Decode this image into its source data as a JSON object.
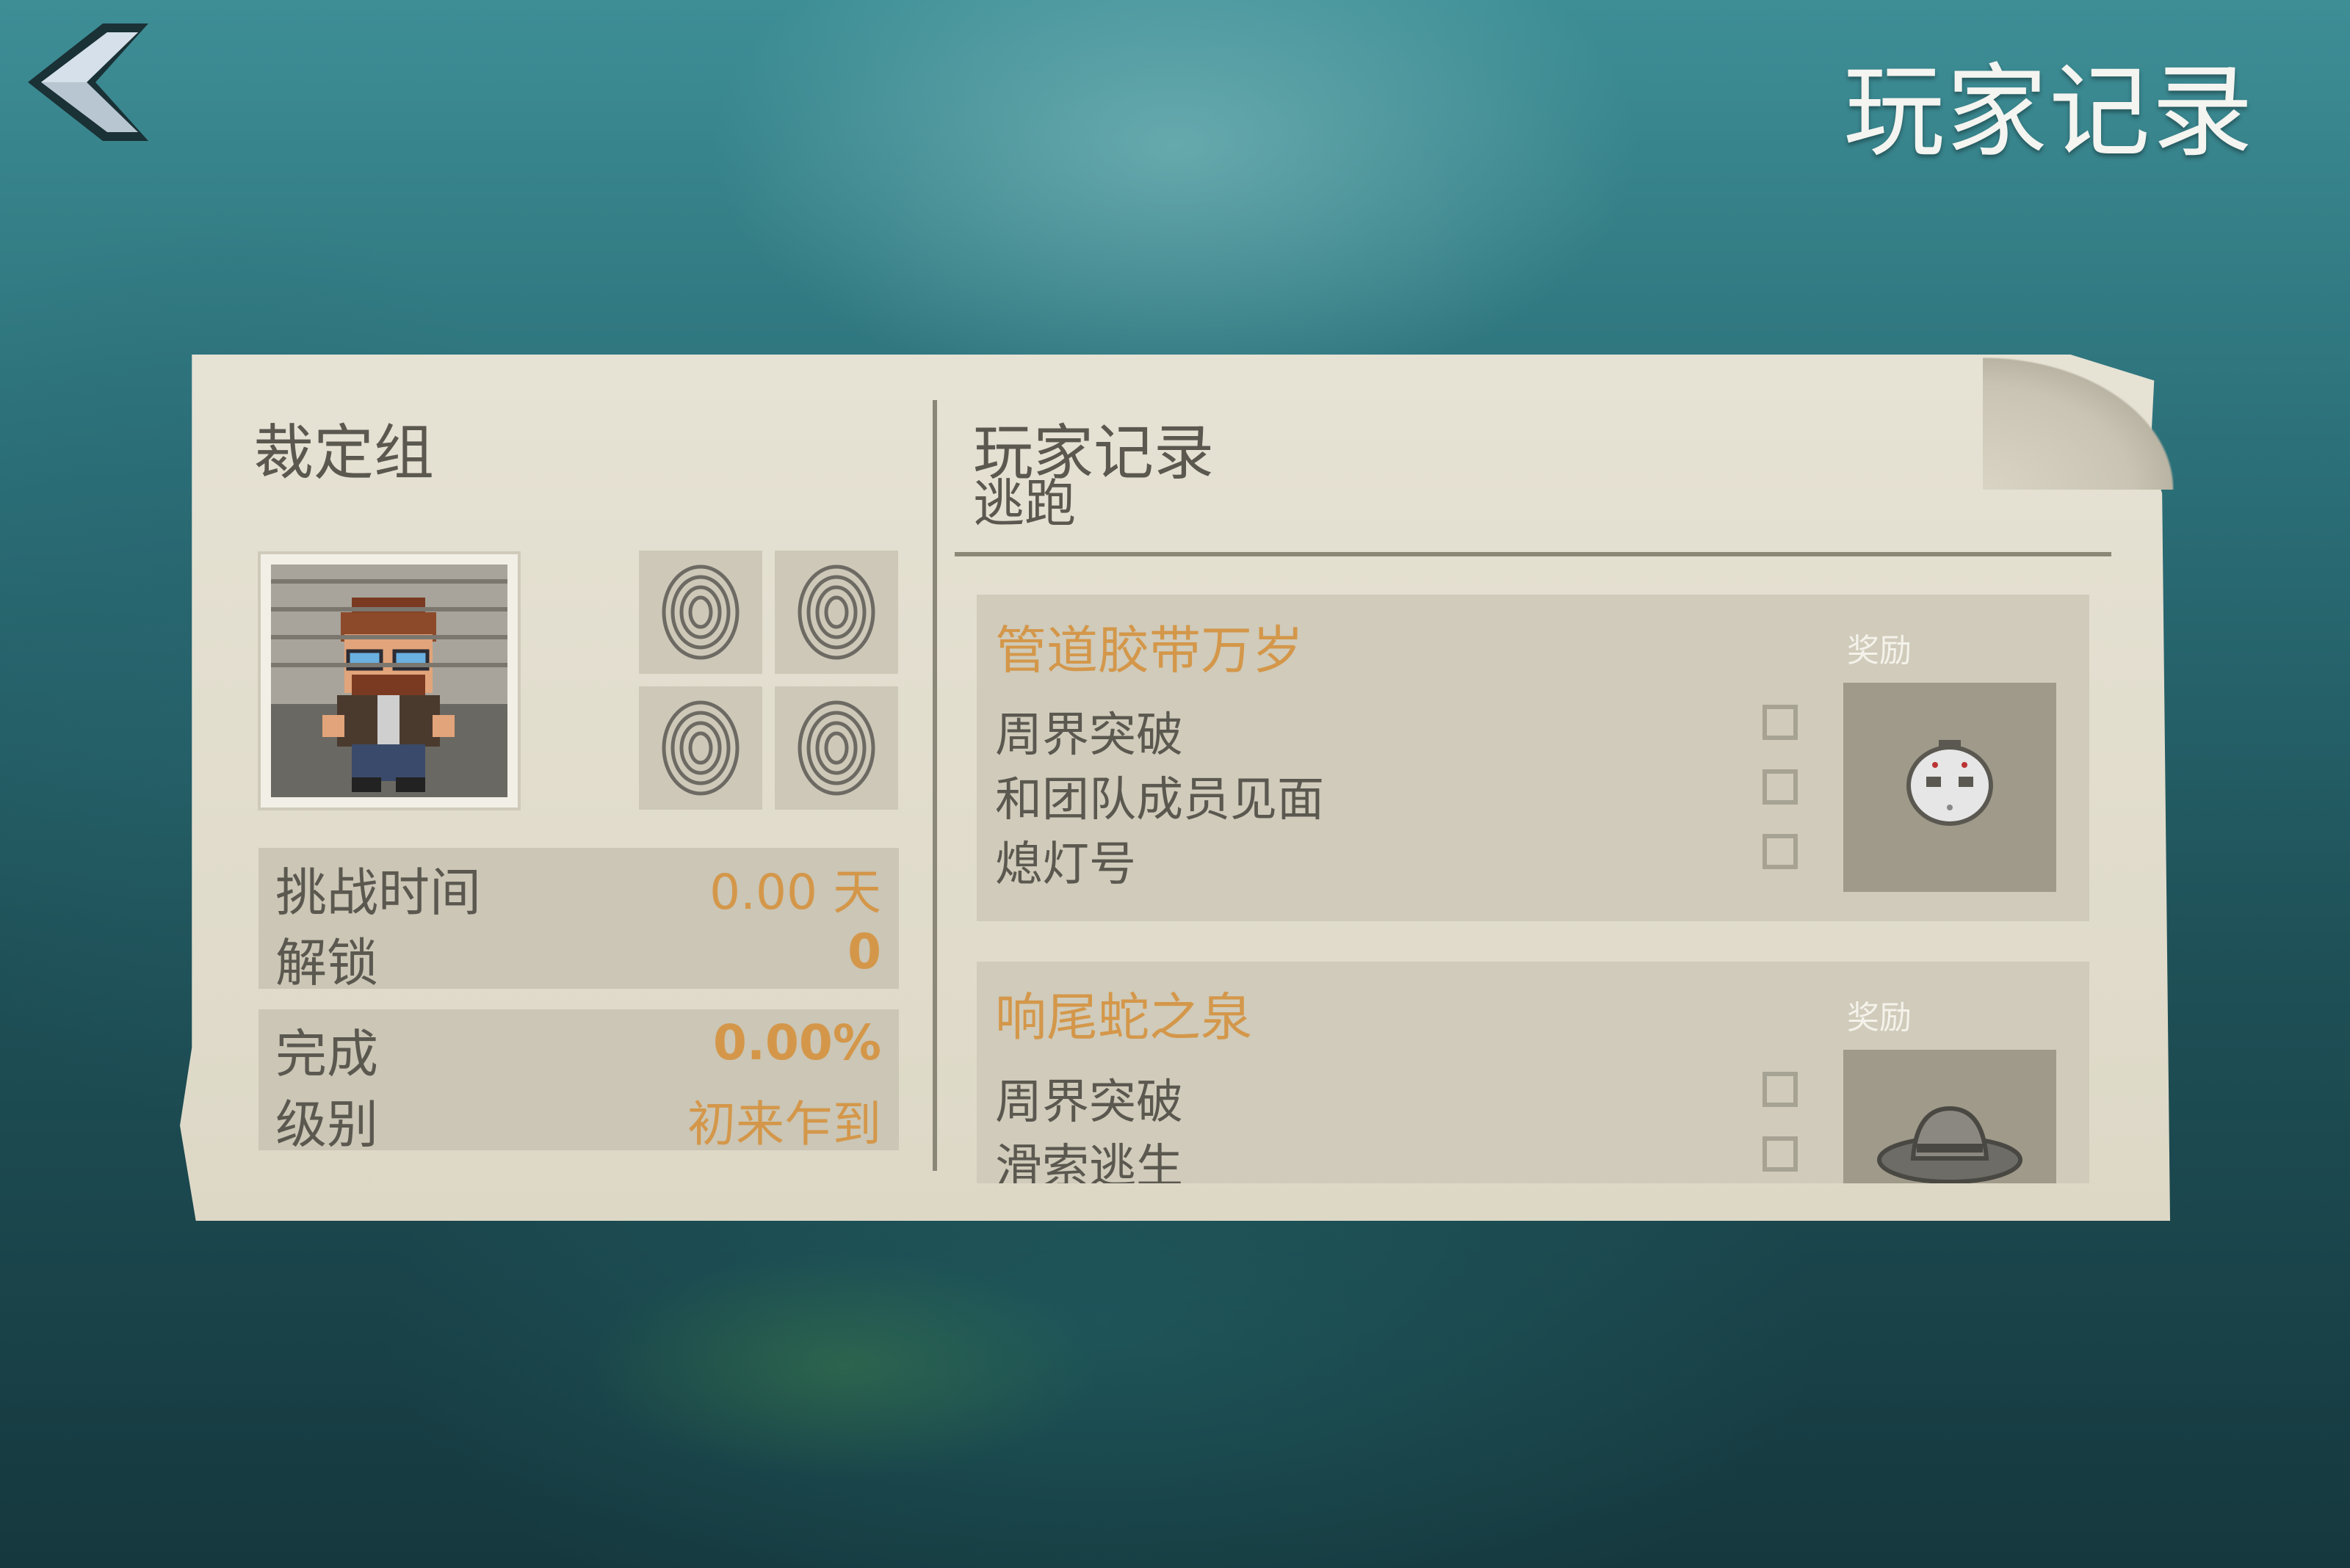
{
  "header": {
    "title": "玩家记录",
    "back_icon": "chevron-left-icon"
  },
  "left_panel": {
    "title": "裁定组",
    "stats_box_1": [
      {
        "label": "挑战时间",
        "value": "0.00 天"
      },
      {
        "label": "解锁",
        "value": "0"
      }
    ],
    "stats_box_2": [
      {
        "label": "完成",
        "value": "0.00%"
      },
      {
        "label": "级别",
        "value": "初来乍到"
      }
    ]
  },
  "right_panel": {
    "title": "玩家记录",
    "subtitle": "逃跑",
    "challenges": [
      {
        "title": "管道胶带万岁",
        "reward_label": "奖励",
        "reward_icon": "hockey-mask-icon",
        "tasks": [
          "周界突破",
          "和团队成员见面",
          "熄灯号"
        ]
      },
      {
        "title": "响尾蛇之泉",
        "reward_label": "奖励",
        "reward_icon": "cowboy-hat-icon",
        "tasks": [
          "周界突破",
          "滑索逃生"
        ]
      }
    ]
  },
  "colors": {
    "accent": "#d4974a",
    "text": "#5b5850",
    "paper": "#e3dfd0"
  }
}
